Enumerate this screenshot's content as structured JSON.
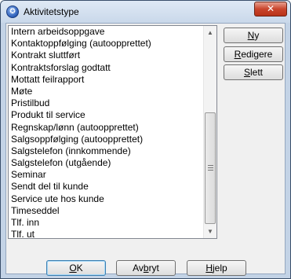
{
  "window": {
    "title": "Aktivitetstype",
    "close_label": "✕"
  },
  "list": {
    "items": [
      "Intern arbeidsoppgave",
      "Kontaktoppfølging (autoopprettet)",
      "Kontrakt sluttført",
      "Kontraktsforslag godtatt",
      "Mottatt feilrapport",
      "Møte",
      "Pristilbud",
      "Produkt til service",
      "Regnskap/lønn (autoopprettet)",
      "Salgsoppfølging (autoopprettet)",
      "Salgstelefon (innkommende)",
      "Salgstelefon (utgående)",
      "Seminar",
      "Sendt del til kunde",
      "Service ute hos kunde",
      "Timeseddel",
      "Tlf. inn",
      "Tlf. ut"
    ]
  },
  "buttons": {
    "ny": {
      "mnemonic": "N",
      "rest": "y"
    },
    "redigere": {
      "mnemonic": "R",
      "rest": "edigere"
    },
    "slett": {
      "mnemonic": "S",
      "rest": "lett"
    },
    "ok": {
      "mnemonic": "O",
      "rest": "K"
    },
    "avbryt": {
      "pre": "Av",
      "mnemonic": "b",
      "rest": "ryt"
    },
    "hjelp": {
      "mnemonic": "H",
      "rest": "jelp"
    }
  },
  "scrollbar": {
    "up_icon": "scroll-up-arrow",
    "down_icon": "scroll-down-arrow"
  }
}
